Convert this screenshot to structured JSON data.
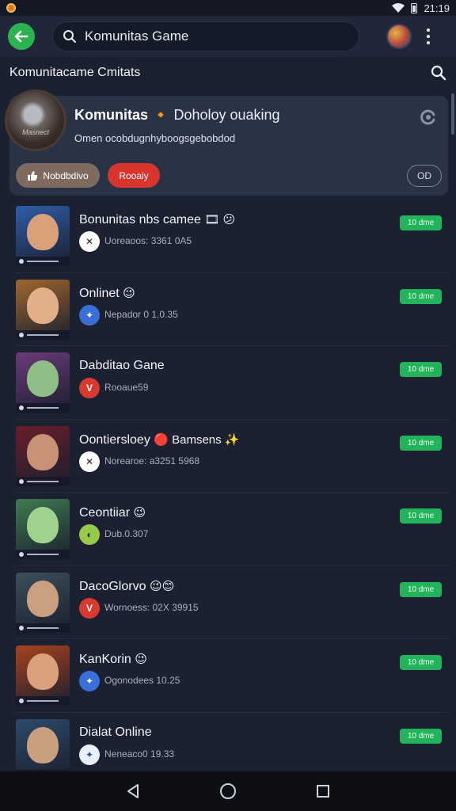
{
  "status_bar": {
    "time": "21:19"
  },
  "appbar": {
    "search_value": "Komunitas Game"
  },
  "section": {
    "title": "Komunitacame Cmitats"
  },
  "community": {
    "avatar_label": "Masnect",
    "title_bold": "Komunitas",
    "title_icon": "🔸",
    "title_rest": "Doholoy ouaking",
    "description": "Omen ocobdugnhyboogsgebobdod",
    "follow_label": "Nobdbdivo",
    "red_label": "Rooaiy",
    "outline_label": "OD"
  },
  "games": [
    {
      "title": "Bonunitas nbs camee",
      "emoji": "🎞 😕",
      "sub": "Uoreaoos: 3361 0A5",
      "badge": "10 dme",
      "sub_icon": "✕",
      "sub_icon_bg": "#ffffff",
      "sub_icon_fg": "#222222",
      "thumb_bg": "#2f5da8",
      "face": "#d9a07a"
    },
    {
      "title": "Onlinet",
      "emoji": "😉",
      "sub": "Nepador 0 1.0.35",
      "badge": "10 dme",
      "sub_icon": "✦",
      "sub_icon_bg": "#3a6fd8",
      "sub_icon_fg": "#ffffff",
      "thumb_bg": "#a0672e",
      "face": "#e1b08a"
    },
    {
      "title": "Dabditao Gane",
      "emoji": "",
      "sub": "Rooaue59",
      "badge": "10 dme",
      "sub_icon": "V",
      "sub_icon_bg": "#d83a2f",
      "sub_icon_fg": "#ffffff",
      "thumb_bg": "#6a3b7a",
      "face": "#8fbf86"
    },
    {
      "title": "Oontiersloey",
      "emoji": "🔴 Bamsens ✨",
      "sub": "Norearoe: a3251 5968",
      "badge": "10 dme",
      "sub_icon": "✕",
      "sub_icon_bg": "#ffffff",
      "sub_icon_fg": "#222222",
      "thumb_bg": "#6b1d2a",
      "face": "#c79276"
    },
    {
      "title": "Ceontiiar",
      "emoji": "😉",
      "sub": "Dub.0.307",
      "badge": "10 dme",
      "sub_icon": "◐",
      "sub_icon_bg": "#97c94a",
      "sub_icon_fg": "#2a2a2a",
      "thumb_bg": "#3f7a4f",
      "face": "#9fd28c"
    },
    {
      "title": "DacoGlorvo",
      "emoji": "😉😊",
      "sub": "Wornoess: 02X 39915",
      "badge": "10 dme",
      "sub_icon": "V",
      "sub_icon_bg": "#d83a2f",
      "sub_icon_fg": "#ffffff",
      "thumb_bg": "#3c4f5a",
      "face": "#caa080"
    },
    {
      "title": "KanKorin",
      "emoji": "😉",
      "sub": "Ogonodees 10.25",
      "badge": "10 dme",
      "sub_icon": "✦",
      "sub_icon_bg": "#3a6fd8",
      "sub_icon_fg": "#ffffff",
      "thumb_bg": "#a8421e",
      "face": "#dba07d"
    },
    {
      "title": "Dialat Online",
      "emoji": "",
      "sub": "Neneaco0 19.33",
      "badge": "10 dme",
      "sub_icon": "✦",
      "sub_icon_bg": "#e8f1fb",
      "sub_icon_fg": "#2a4a8a",
      "thumb_bg": "#2c4a6a",
      "face": "#c8a07e"
    }
  ]
}
